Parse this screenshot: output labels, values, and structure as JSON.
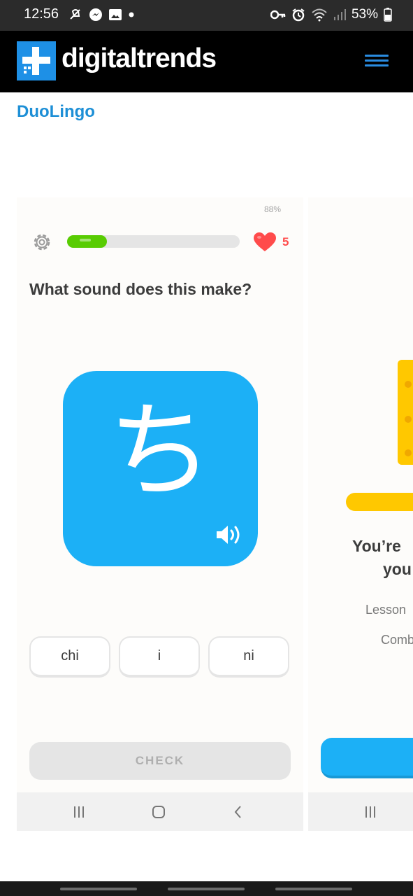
{
  "status_bar": {
    "time": "12:56",
    "battery": "53%",
    "left_icons": [
      "notification-icon",
      "messenger-icon",
      "image-icon",
      "dot-icon"
    ],
    "right_icons": [
      "key-icon",
      "alarm-icon",
      "wifi-icon",
      "signal-icon",
      "battery-icon"
    ]
  },
  "site": {
    "logo_text": "digitaltrends",
    "menu_icon": "hamburger-icon",
    "brand_color": "#1e90e6"
  },
  "article": {
    "heading": "DuoLingo"
  },
  "screenshot_1": {
    "battery": "88%",
    "progress": 0.23,
    "hearts": "5",
    "question": "What sound does this make?",
    "character": "ち",
    "choices": [
      "chi",
      "i",
      "ni"
    ],
    "check_label": "CHECK",
    "accent_color": "#1cb0f6",
    "progress_color": "#58cc02",
    "heart_color": "#ff4b4b"
  },
  "screenshot_2": {
    "title_line1": "You’re",
    "title_line2": "you",
    "lesson_text": "Lesson",
    "comb_text": "Comb"
  }
}
